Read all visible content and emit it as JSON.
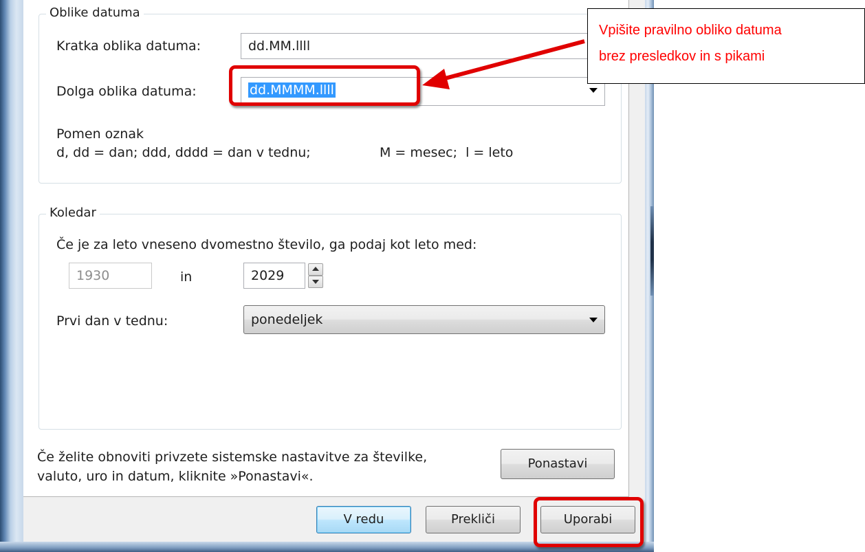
{
  "date_formats": {
    "group_title": "Oblike datuma",
    "short_label": "Kratka oblika datuma:",
    "short_value": "dd.MM.llll",
    "long_label": "Dolga oblika datuma:",
    "long_value": "dd.MMMM.llll",
    "legend_title": "Pomen oznak",
    "legend_days": "d, dd = dan; ddd, dddd = dan v tednu;",
    "legend_month_year": "M = mesec;  l = leto"
  },
  "calendar": {
    "group_title": "Koledar",
    "two_digit_label": "Če je za leto vneseno dvomestno število, ga podaj kot leto med:",
    "year_from": "1930",
    "and_label": "in",
    "year_to": "2029",
    "first_day_label": "Prvi dan v tednu:",
    "first_day_value": "ponedeljek"
  },
  "reset": {
    "text_line1": "Če želite obnoviti privzete sistemske nastavitve za številke,",
    "text_line2": "valuto, uro in datum, kliknite »Ponastavi«.",
    "button": "Ponastavi"
  },
  "buttons": {
    "ok": "V redu",
    "cancel": "Prekliči",
    "apply": "Uporabi"
  },
  "annotation": {
    "line1": "Vpišite pravilno obliko datuma",
    "line2": "brez presledkov in s pikami",
    "color": "#ff0000"
  }
}
